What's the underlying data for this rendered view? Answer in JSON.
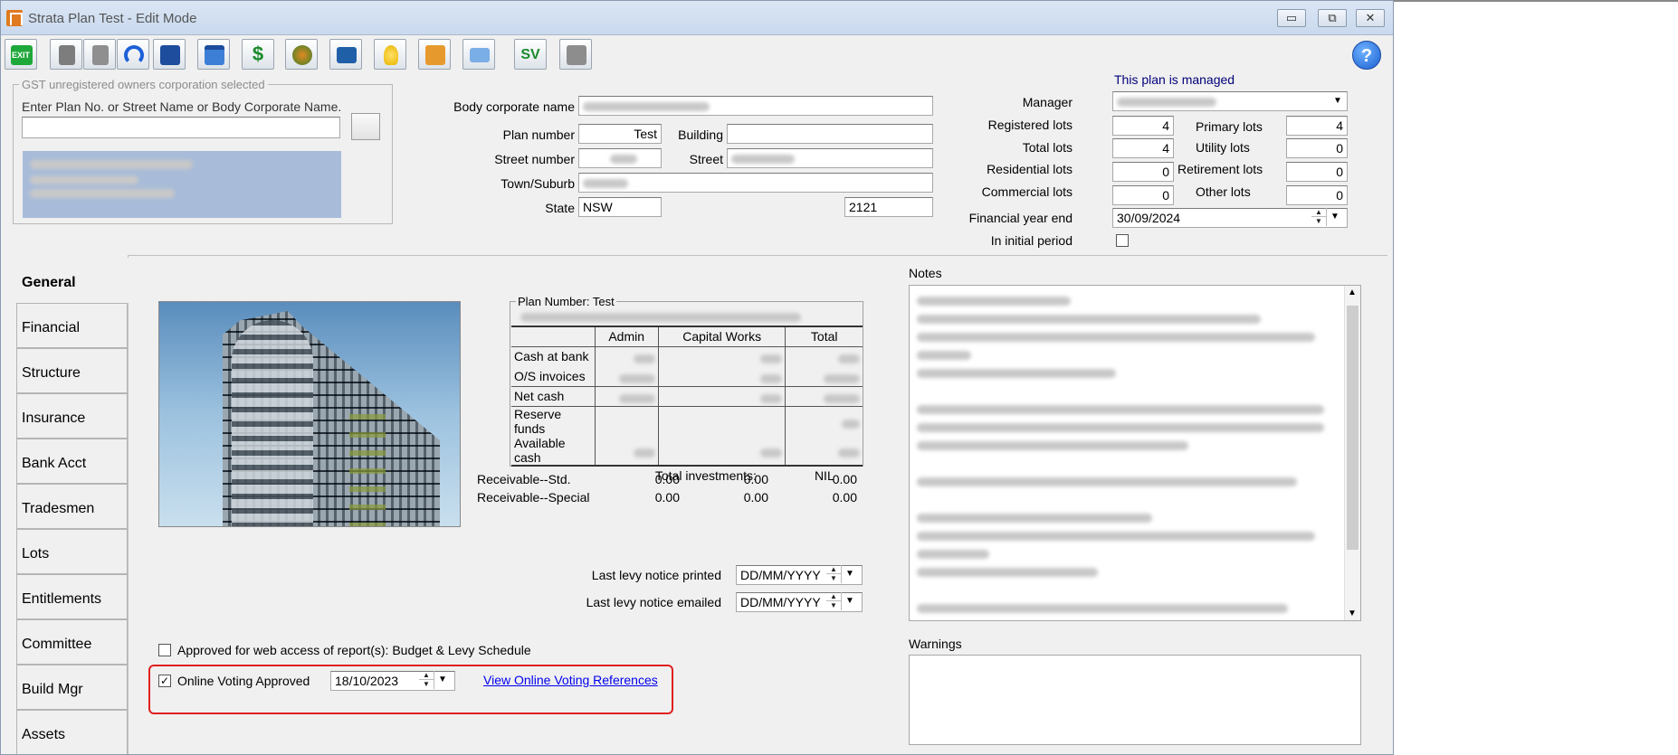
{
  "window": {
    "title": "Strata Plan Test - Edit Mode",
    "controls": {
      "minimize": "▭",
      "maximize": "⧉",
      "close": "✕"
    }
  },
  "toolbar": {
    "exit_label": "EXIT",
    "sv_label": "SV",
    "help_label": "?",
    "icons": [
      "exit-icon",
      "new-doc-icon",
      "copy-doc-icon",
      "undo-icon",
      "save-icon",
      "calendar-icon",
      "money-icon",
      "coins-icon",
      "folder-icon",
      "lightbulb-icon",
      "briefcase-icon",
      "mail-icon",
      "sv-check-icon",
      "blank-icon"
    ]
  },
  "search": {
    "legend": "GST unregistered owners corporation selected",
    "prompt": "Enter Plan No. or Street Name or Body Corporate Name.",
    "value": ""
  },
  "plan": {
    "body_corporate_label": "Body corporate name",
    "plan_number_label": "Plan number",
    "plan_number": "Test",
    "building_label": "Building",
    "building": "",
    "street_number_label": "Street number",
    "street_label": "Street",
    "town_label": "Town/Suburb",
    "state_label": "State",
    "state": "NSW",
    "postcode": "2121"
  },
  "lots": {
    "managed_note": "This plan is managed",
    "manager_label": "Manager",
    "registered_label": "Registered lots",
    "registered": "4",
    "primary_label": "Primary lots",
    "primary": "4",
    "total_label": "Total lots",
    "total": "4",
    "utility_label": "Utility lots",
    "utility": "0",
    "residential_label": "Residential lots",
    "residential": "0",
    "retirement_label": "Retirement lots",
    "retirement": "0",
    "commercial_label": "Commercial lots",
    "commercial": "0",
    "other_label": "Other lots",
    "other": "0",
    "fy_end_label": "Financial year end",
    "fy_end": "30/09/2024",
    "initial_period_label": "In initial period"
  },
  "tabs": [
    "General",
    "Financial",
    "Structure",
    "Insurance",
    "Bank Acct",
    "Tradesmen",
    "Lots",
    "Entitlements",
    "Committee",
    "Build Mgr",
    "Assets"
  ],
  "summary": {
    "legend": "Plan Number: Test",
    "columns": [
      "",
      "Admin",
      "Capital Works",
      "Total"
    ],
    "rows": [
      "Cash at bank",
      "O/S invoices",
      "Net cash",
      "Reserve funds",
      "Available cash"
    ],
    "total_investments_label": "Total investments:",
    "total_investments": "NIL",
    "receivables": [
      {
        "label": "Receivable--Std.",
        "admin": "0.00",
        "capital": "0.00",
        "total": "0.00"
      },
      {
        "label": "Receivable--Special",
        "admin": "0.00",
        "capital": "0.00",
        "total": "0.00"
      }
    ]
  },
  "levy": {
    "printed_label": "Last levy notice printed",
    "printed_value": "DD/MM/YYYY",
    "emailed_label": "Last levy notice emailed",
    "emailed_value": "DD/MM/YYYY"
  },
  "web_access": {
    "label": "Approved for web access of report(s): Budget & Levy Schedule",
    "checked": false
  },
  "voting": {
    "label": "Online Voting Approved",
    "checked_mark": "✓",
    "date": "18/10/2023",
    "link": "View Online Voting References"
  },
  "notes": {
    "label": "Notes"
  },
  "warnings": {
    "label": "Warnings"
  },
  "colors": {
    "accent_red": "#e02020",
    "link_blue": "#0000ee",
    "selection": "#a8bcd9"
  }
}
